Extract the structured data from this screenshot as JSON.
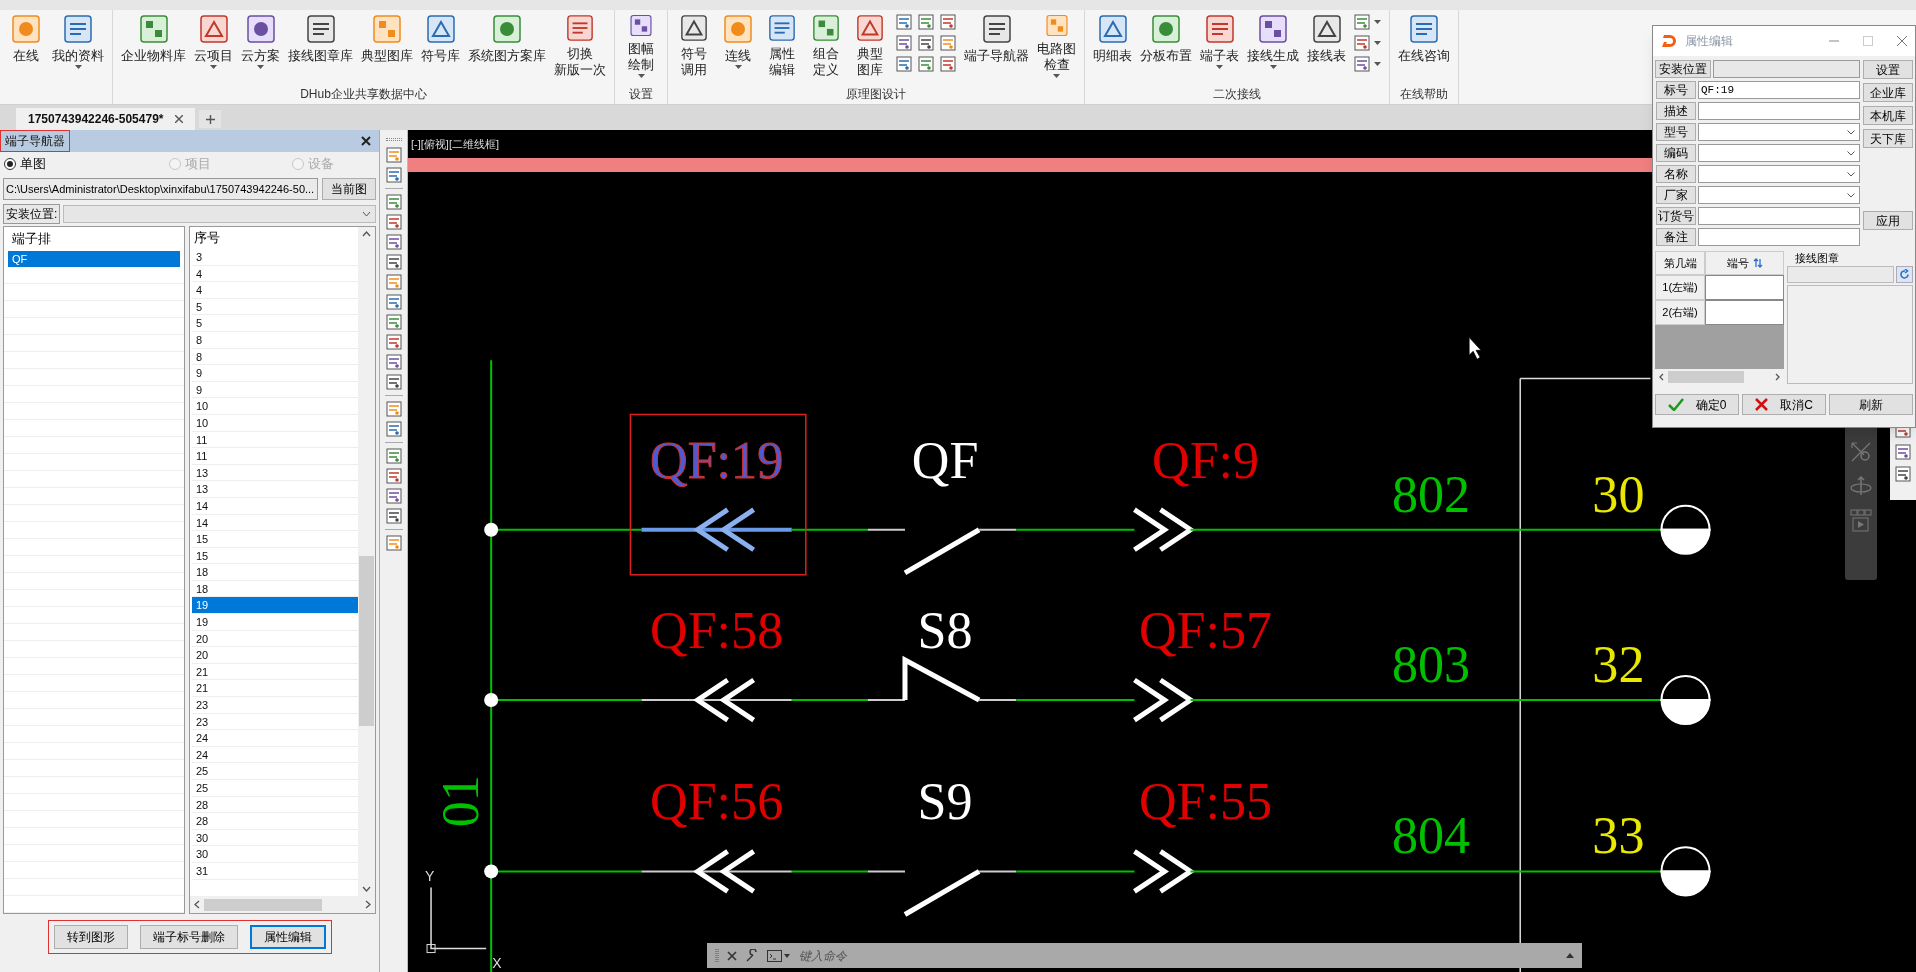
{
  "ribbon": {
    "groups": [
      {
        "items": [
          {
            "kind": "large",
            "lines": [
              "在线"
            ]
          },
          {
            "kind": "large",
            "lines": [
              "我的资料"
            ],
            "dropdown": true
          }
        ]
      },
      {
        "label": "DHub企业共享数据中心",
        "items": [
          {
            "kind": "large",
            "lines": [
              "企业物料库"
            ]
          },
          {
            "kind": "large",
            "lines": [
              "云项目"
            ],
            "dropdown": true
          },
          {
            "kind": "large",
            "lines": [
              "云方案"
            ],
            "dropdown": true
          },
          {
            "kind": "large",
            "lines": [
              "接线图章库"
            ]
          },
          {
            "kind": "large",
            "lines": [
              "典型图库"
            ]
          },
          {
            "kind": "large",
            "lines": [
              "符号库"
            ]
          },
          {
            "kind": "large",
            "lines": [
              "系统图方案库"
            ]
          },
          {
            "kind": "large",
            "lines": [
              "切换",
              "新版一次"
            ]
          }
        ]
      },
      {
        "label": "设置",
        "items": [
          {
            "kind": "large",
            "lines": [
              "图幅",
              "绘制"
            ],
            "dropdown": true
          }
        ]
      },
      {
        "label": "原理图设计",
        "items": [
          {
            "kind": "large",
            "lines": [
              "符号",
              "调用"
            ]
          },
          {
            "kind": "large",
            "lines": [
              "连线"
            ],
            "dropdown": true
          },
          {
            "kind": "large",
            "lines": [
              "属性",
              "编辑"
            ]
          },
          {
            "kind": "large",
            "lines": [
              "组合",
              "定义"
            ]
          },
          {
            "kind": "large",
            "lines": [
              "典型",
              "图库"
            ]
          },
          {
            "kind": "grid"
          },
          {
            "kind": "large",
            "lines": [
              "端子导航器"
            ]
          },
          {
            "kind": "large",
            "lines": [
              "电路图",
              "检查"
            ],
            "dropdown": true
          }
        ]
      },
      {
        "label": "二次接线",
        "items": [
          {
            "kind": "large",
            "lines": [
              "明细表"
            ]
          },
          {
            "kind": "large",
            "lines": [
              "分板布置"
            ]
          },
          {
            "kind": "large",
            "lines": [
              "端子表"
            ],
            "dropdown": true
          },
          {
            "kind": "large",
            "lines": [
              "接线生成"
            ],
            "dropdown": true
          },
          {
            "kind": "large",
            "lines": [
              "接线表"
            ]
          },
          {
            "kind": "column"
          }
        ]
      },
      {
        "label": "在线帮助",
        "items": [
          {
            "kind": "large",
            "lines": [
              "在线咨询"
            ]
          }
        ]
      }
    ]
  },
  "doc_tabs": [
    {
      "label": "1750743942246-505479*",
      "selected": true
    }
  ],
  "navigator": {
    "title": "端子导航器",
    "scope": [
      {
        "label": "单图",
        "selected": true,
        "disabled": false
      },
      {
        "label": "项目",
        "selected": false,
        "disabled": true
      },
      {
        "label": "设备",
        "selected": false,
        "disabled": true
      }
    ],
    "path": "C:\\Users\\Administrator\\Desktop\\xinxifabu\\1750743942246-50...",
    "current_button": "当前图",
    "location_label": "安装位置:",
    "strips": {
      "header": "端子排",
      "items": [
        {
          "label": "QF",
          "selected": true
        }
      ]
    },
    "numbers": {
      "header": "序号",
      "items": [
        {
          "label": "3",
          "selected": false
        },
        {
          "label": "4",
          "selected": false
        },
        {
          "label": "4",
          "selected": false
        },
        {
          "label": "5",
          "selected": false
        },
        {
          "label": "5",
          "selected": false
        },
        {
          "label": "8",
          "selected": false
        },
        {
          "label": "8",
          "selected": false
        },
        {
          "label": "9",
          "selected": false
        },
        {
          "label": "9",
          "selected": false
        },
        {
          "label": "10",
          "selected": false
        },
        {
          "label": "10",
          "selected": false
        },
        {
          "label": "11",
          "selected": false
        },
        {
          "label": "11",
          "selected": false
        },
        {
          "label": "13",
          "selected": false
        },
        {
          "label": "13",
          "selected": false
        },
        {
          "label": "14",
          "selected": false
        },
        {
          "label": "14",
          "selected": false
        },
        {
          "label": "15",
          "selected": false
        },
        {
          "label": "15",
          "selected": false
        },
        {
          "label": "18",
          "selected": false
        },
        {
          "label": "18",
          "selected": false
        },
        {
          "label": "19",
          "selected": true
        },
        {
          "label": "19",
          "selected": false
        },
        {
          "label": "20",
          "selected": false
        },
        {
          "label": "20",
          "selected": false
        },
        {
          "label": "21",
          "selected": false
        },
        {
          "label": "21",
          "selected": false
        },
        {
          "label": "23",
          "selected": false
        },
        {
          "label": "23",
          "selected": false
        },
        {
          "label": "24",
          "selected": false
        },
        {
          "label": "24",
          "selected": false
        },
        {
          "label": "25",
          "selected": false
        },
        {
          "label": "25",
          "selected": false
        },
        {
          "label": "28",
          "selected": false
        },
        {
          "label": "28",
          "selected": false
        },
        {
          "label": "30",
          "selected": false
        },
        {
          "label": "30",
          "selected": false
        },
        {
          "label": "31",
          "selected": false
        }
      ]
    },
    "buttons": [
      {
        "label": "转到图形",
        "focused": false
      },
      {
        "label": "端子标号删除",
        "focused": false
      },
      {
        "label": "属性编辑",
        "focused": true
      }
    ]
  },
  "canvas": {
    "viewport_label": "[-][俯视][二维线框]",
    "bus_label": "01",
    "ucs": {
      "y": "Y",
      "x": "X"
    },
    "circuits": [
      {
        "tag": "QF:19",
        "selected": true,
        "switch": "QF",
        "kind": "plain",
        "right_tag": "QF:9",
        "wire": "802",
        "terminal": "30"
      },
      {
        "tag": "QF:58",
        "selected": false,
        "switch": "S8",
        "kind": "step",
        "right_tag": "QF:57",
        "wire": "803",
        "terminal": "32"
      },
      {
        "tag": "QF:56",
        "selected": false,
        "switch": "S9",
        "kind": "plain",
        "right_tag": "QF:55",
        "wire": "804",
        "terminal": "33"
      }
    ],
    "command": {
      "placeholder": "键入命令"
    }
  },
  "dialog": {
    "title": "属性编辑",
    "fields": [
      {
        "label": "安装位置",
        "kind": "readonly"
      },
      {
        "label": "标号",
        "kind": "text",
        "value": "QF:19"
      },
      {
        "label": "描述",
        "kind": "text"
      },
      {
        "label": "型号",
        "kind": "select"
      },
      {
        "label": "编码",
        "kind": "select"
      },
      {
        "label": "名称",
        "kind": "select"
      },
      {
        "label": "厂家",
        "kind": "select"
      },
      {
        "label": "订货号",
        "kind": "text"
      },
      {
        "label": "备注",
        "kind": "text"
      }
    ],
    "side_buttons": [
      "设置",
      "企业库",
      "本机库",
      "天下库",
      "应用"
    ],
    "ends": {
      "columns": [
        "第几端",
        "端号"
      ],
      "rows": [
        "1(左端)",
        "2(右端)"
      ]
    },
    "stamp": {
      "title": "接线图章"
    },
    "footer": [
      {
        "label": "确定0",
        "kind": "ok"
      },
      {
        "label": "取消C",
        "kind": "cancel"
      },
      {
        "label": "刷新",
        "kind": "plain"
      }
    ]
  }
}
